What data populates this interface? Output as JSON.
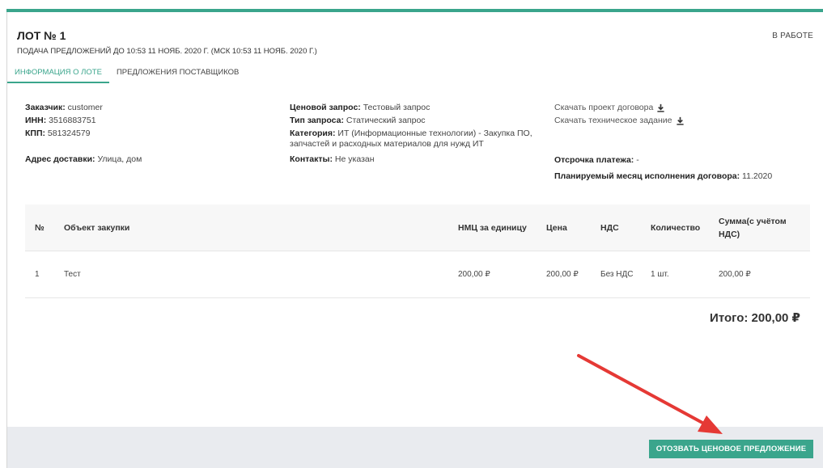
{
  "lot": {
    "title": "ЛОТ № 1",
    "status": "В РАБОТЕ",
    "deadline": "ПОДАЧА ПРЕДЛОЖЕНИЙ ДО 10:53 11 НОЯБ. 2020 Г. (МСК 10:53 11 НОЯБ. 2020 Г.)"
  },
  "tabs": [
    {
      "label": "ИНФОРМАЦИЯ О ЛОТЕ",
      "active": true
    },
    {
      "label": "ПРЕДЛОЖЕНИЯ ПОСТАВЩИКОВ",
      "active": false
    }
  ],
  "info": {
    "customer_label": "Заказчик:",
    "customer_value": " customer",
    "inn_label": "ИНН:",
    "inn_value": " 3516883751",
    "kpp_label": "КПП:",
    "kpp_value": " 581324579",
    "address_label": "Адрес доставки:",
    "address_value": " Улица, дом",
    "request_label": "Ценовой запрос:",
    "request_value": " Тестовый запрос",
    "type_label": "Тип запроса:",
    "type_value": " Статический запрос",
    "category_label": "Категория:",
    "category_value": " ИТ (Информационные технологии) - Закупка ПО, запчастей и расходных материалов для нужд ИТ",
    "contacts_label": "Контакты:",
    "contacts_value": " Не указан",
    "download_contract": "Скачать проект договора",
    "download_spec": "Скачать техническое задание",
    "payment_delay_label": "Отсрочка платежа:",
    "payment_delay_value": " -",
    "planned_month_label": "Планируемый месяц исполнения договора:",
    "planned_month_value": " 11.2020"
  },
  "icons": {
    "download": "download-icon"
  },
  "table": {
    "headers": {
      "num": "№",
      "object": "Объект закупки",
      "nmc": "НМЦ за единицу",
      "price": "Цена",
      "vat": "НДС",
      "qty": "Количество",
      "sum": "Сумма(с учётом НДС)"
    },
    "rows": [
      {
        "num": "1",
        "object": "Тест",
        "nmc": "200,00 ₽",
        "price": "200,00 ₽",
        "vat": "Без НДС",
        "qty": "1 шт.",
        "sum": "200,00 ₽"
      }
    ]
  },
  "total": "Итого: 200,00 ₽",
  "actions": {
    "withdraw_label": "ОТОЗВАТЬ ЦЕНОВОЕ ПРЕДЛОЖЕНИЕ"
  },
  "colors": {
    "accent": "#3aa58c",
    "annotation_arrow": "#e53935",
    "footer_bg": "#e9ebef"
  }
}
